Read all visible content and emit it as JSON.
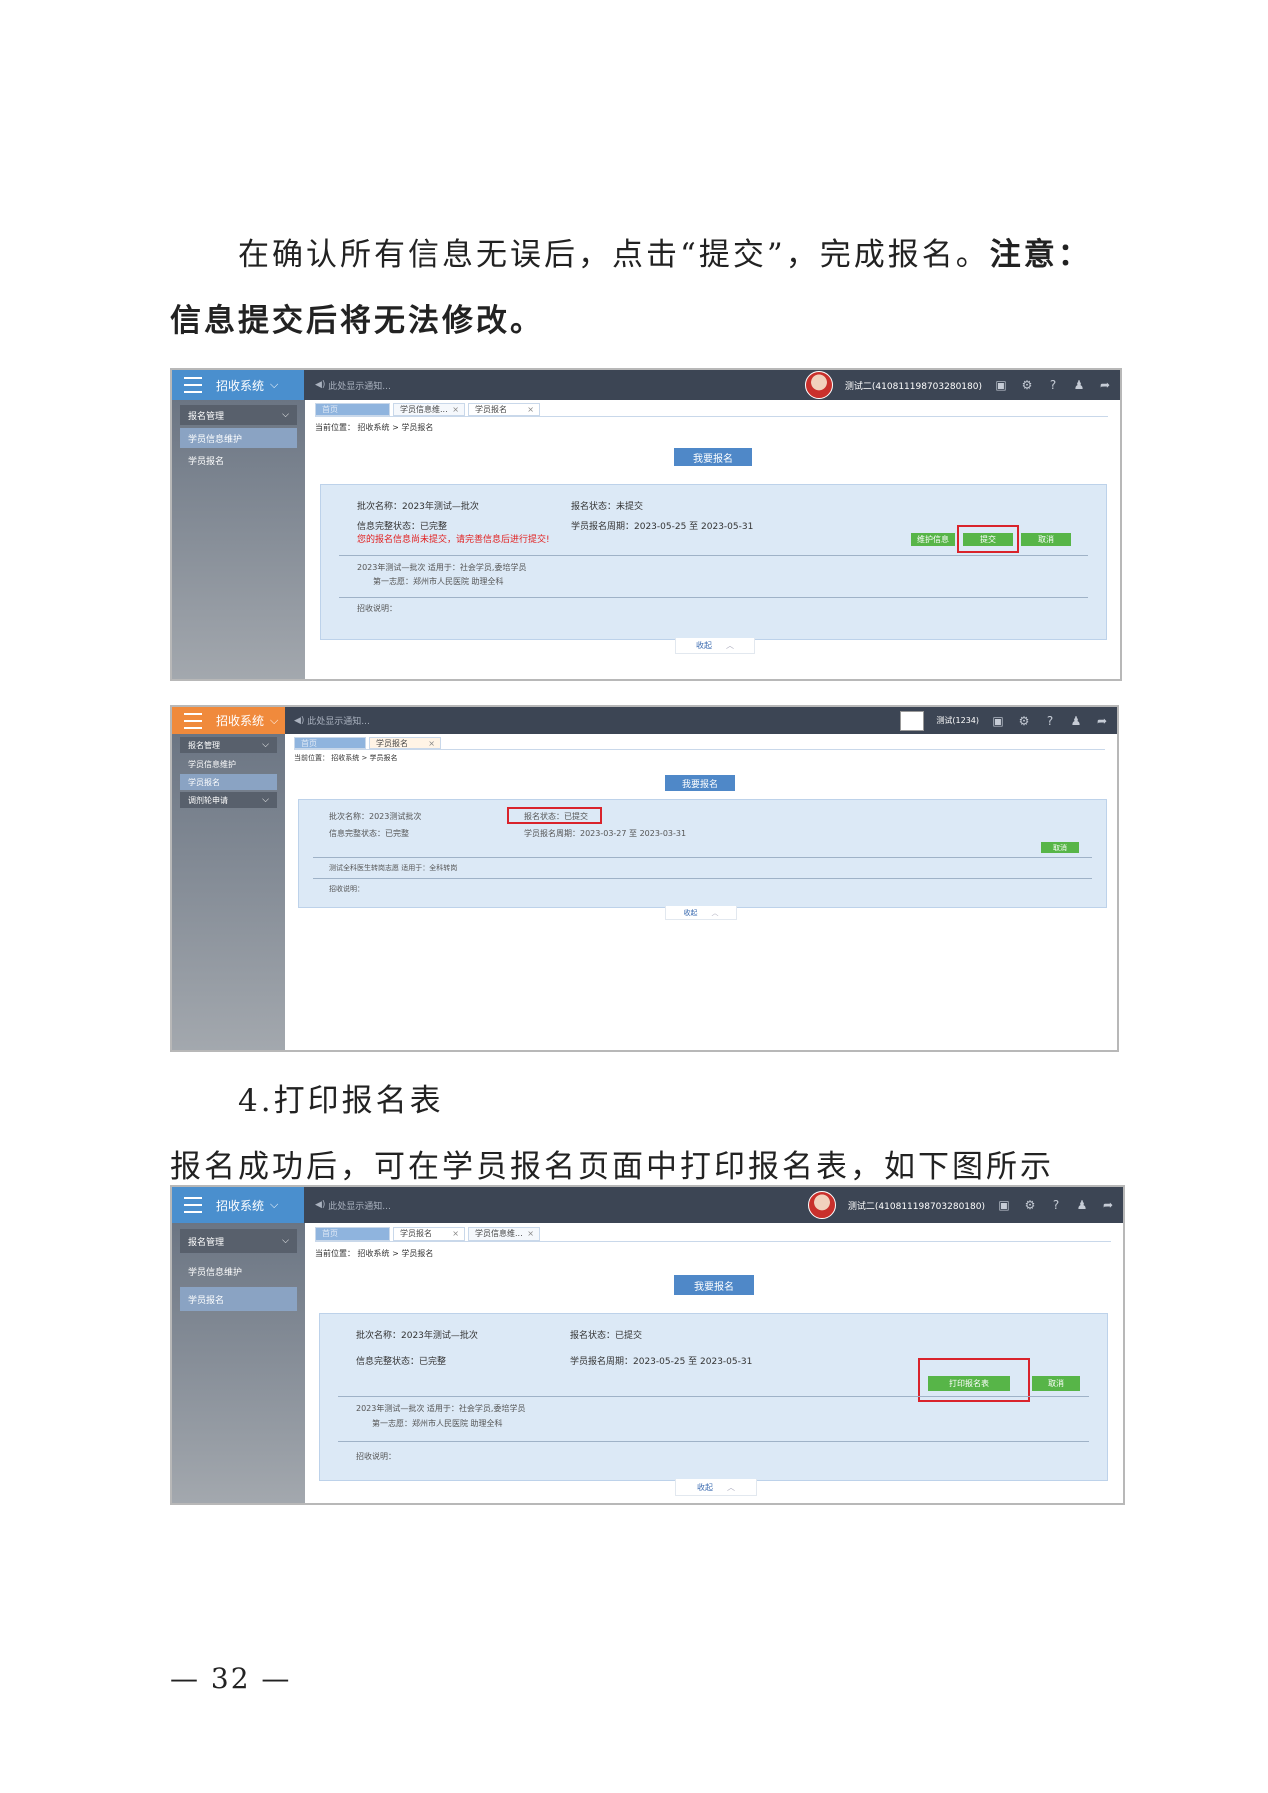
{
  "doc": {
    "intro_normal": "在确认所有信息无误后，点击“提交”，完成报名。",
    "intro_bold_1": "注意：",
    "intro_bold_2": "信息提交后将无法修改。",
    "section_heading": "4.打印报名表",
    "section_text": "报名成功后，可在学员报名页面中打印报名表，如下图所示",
    "page_number": "— 32 —"
  },
  "shot1": {
    "system_name": "招收系统",
    "notice": "此处显示通知...",
    "user": "测试二(410811198703280180)",
    "menu_group": "报名管理",
    "menu_items": [
      "学员信息维护",
      "学员报名"
    ],
    "tabs": [
      "首页",
      "学员信息维...",
      "学员报名"
    ],
    "breadcrumb": "当前位置：  招收系统 > 学员报名",
    "apply_button": "我要报名",
    "batch": "批次名称：2023年测试—批次",
    "status": "报名状态：未提交",
    "completeness": "信息完整状态：已完整",
    "period": "学员报名周期：2023-05-25 至 2023-05-31",
    "warning": "您的报名信息尚未提交，请完善信息后进行提交!",
    "btn_maintain": "维护信息",
    "btn_submit": "提交",
    "btn_cancel": "取消",
    "applies": "2023年测试—批次 适用于：社会学员,委培学员",
    "choice": "第一志愿：郑州市人民医院    助理全科",
    "remark": "招收说明：",
    "fold": "收起"
  },
  "shot2": {
    "system_name": "招收系统",
    "notice": "此处显示通知...",
    "user": "测试(1234)",
    "menu_group": "报名管理",
    "menu_items": [
      "学员信息维护",
      "学员报名"
    ],
    "menu_group2": "调剂轮申请",
    "tabs": [
      "首页",
      "学员报名"
    ],
    "breadcrumb": "当前位置：  招收系统 > 学员报名",
    "apply_button": "我要报名",
    "batch": "批次名称：2023测试批次",
    "status": "报名状态：已提交",
    "completeness": "信息完整状态：已完整",
    "period": "学员报名周期：2023-03-27 至 2023-03-31",
    "btn_cancel": "取消",
    "applies": "测试全科医生转岗志愿 适用于：全科转岗",
    "remark": "招收说明：",
    "fold": "收起"
  },
  "shot3": {
    "system_name": "招收系统",
    "notice": "此处显示通知...",
    "user": "测试二(410811198703280180)",
    "menu_group": "报名管理",
    "menu_items": [
      "学员信息维护",
      "学员报名"
    ],
    "tabs": [
      "首页",
      "学员报名",
      "学员信息维..."
    ],
    "breadcrumb": "当前位置：  招收系统 > 学员报名",
    "apply_button": "我要报名",
    "batch": "批次名称：2023年测试—批次",
    "status": "报名状态：已提交",
    "completeness": "信息完整状态：已完整",
    "period": "学员报名周期：2023-05-25 至 2023-05-31",
    "btn_print": "打印报名表",
    "btn_cancel": "取消",
    "applies": "2023年测试—批次 适用于：社会学员,委培学员",
    "choice": "第一志愿：郑州市人民医院    助理全科",
    "remark": "招收说明：",
    "fold": "收起"
  },
  "colors": {
    "topbar": "#3c4554",
    "brand_blue": "#4a8fce",
    "brand_orange": "#f08a3c",
    "card": "#dce9f6",
    "green_button": "#57b548",
    "highlight_red": "#d9232b"
  }
}
